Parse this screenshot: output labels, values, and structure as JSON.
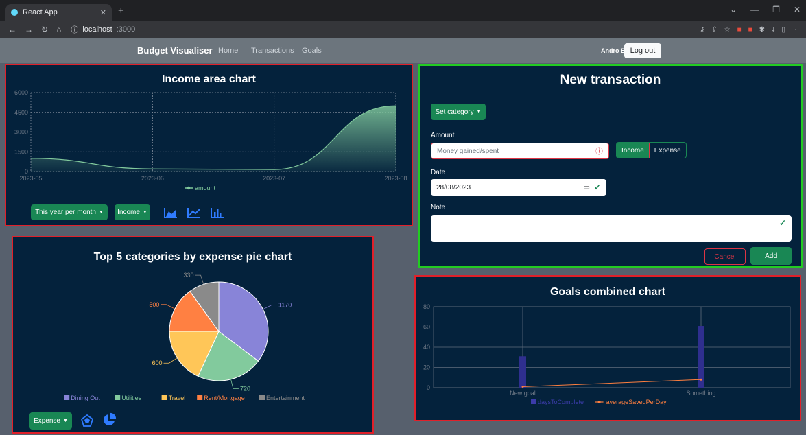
{
  "browser": {
    "tab_title": "React App",
    "url_host": "localhost",
    "url_port": ":3000"
  },
  "navbar": {
    "brand": "Budget Visualiser",
    "links": [
      "Home",
      "Transactions",
      "Goals"
    ],
    "user": "Andro Bulj",
    "logout": "Log out"
  },
  "income_panel": {
    "title": "Income area chart",
    "period_button": "This year per month",
    "type_button": "Income",
    "legend": "amount"
  },
  "pie_panel": {
    "title": "Top 5 categories by expense pie chart",
    "type_button": "Expense"
  },
  "transaction_panel": {
    "title": "New transaction",
    "category_button": "Set category",
    "amount_label": "Amount",
    "amount_placeholder": "Money gained/spent",
    "income_toggle": "Income",
    "expense_toggle": "Expense",
    "date_label": "Date",
    "date_value": "28/08/2023",
    "note_label": "Note",
    "cancel": "Cancel",
    "add": "Add"
  },
  "goals_panel": {
    "title": "Goals combined chart"
  },
  "colors": {
    "panel_bg": "#04223c",
    "income_area": "#82ca9d",
    "bar": "#2f2f8f",
    "line": "#ff7f3f",
    "green_btn": "#198754"
  },
  "chart_data": [
    {
      "type": "area",
      "title": "Income area chart",
      "x": [
        "2023-05",
        "2023-06",
        "2023-07",
        "2023-08"
      ],
      "series": [
        {
          "name": "amount",
          "values": [
            1000,
            200,
            150,
            5000
          ]
        }
      ],
      "ylim": [
        0,
        6000
      ],
      "yticks": [
        0,
        1500,
        3000,
        4500,
        6000
      ],
      "grid": true,
      "legend": "bottom"
    },
    {
      "type": "pie",
      "title": "Top 5 categories by expense pie chart",
      "categories": [
        "Dining Out",
        "Utilities",
        "Travel",
        "Rent/Mortgage",
        "Entertainment"
      ],
      "values": [
        1170,
        720,
        600,
        500,
        330
      ],
      "colors": [
        "#8884d8",
        "#82ca9d",
        "#ffc658",
        "#ff8042",
        "#8a8a8a"
      ],
      "legend": "bottom"
    },
    {
      "type": "bar",
      "title": "Goals combined chart",
      "categories": [
        "New goal",
        "Something"
      ],
      "series": [
        {
          "name": "daysToComplete",
          "values": [
            31,
            61
          ],
          "kind": "bar"
        },
        {
          "name": "averageSavedPerDay",
          "values": [
            1,
            8
          ],
          "kind": "line"
        }
      ],
      "ylim": [
        0,
        80
      ],
      "yticks": [
        0,
        20,
        40,
        60,
        80
      ],
      "grid": true,
      "legend": "bottom"
    }
  ]
}
